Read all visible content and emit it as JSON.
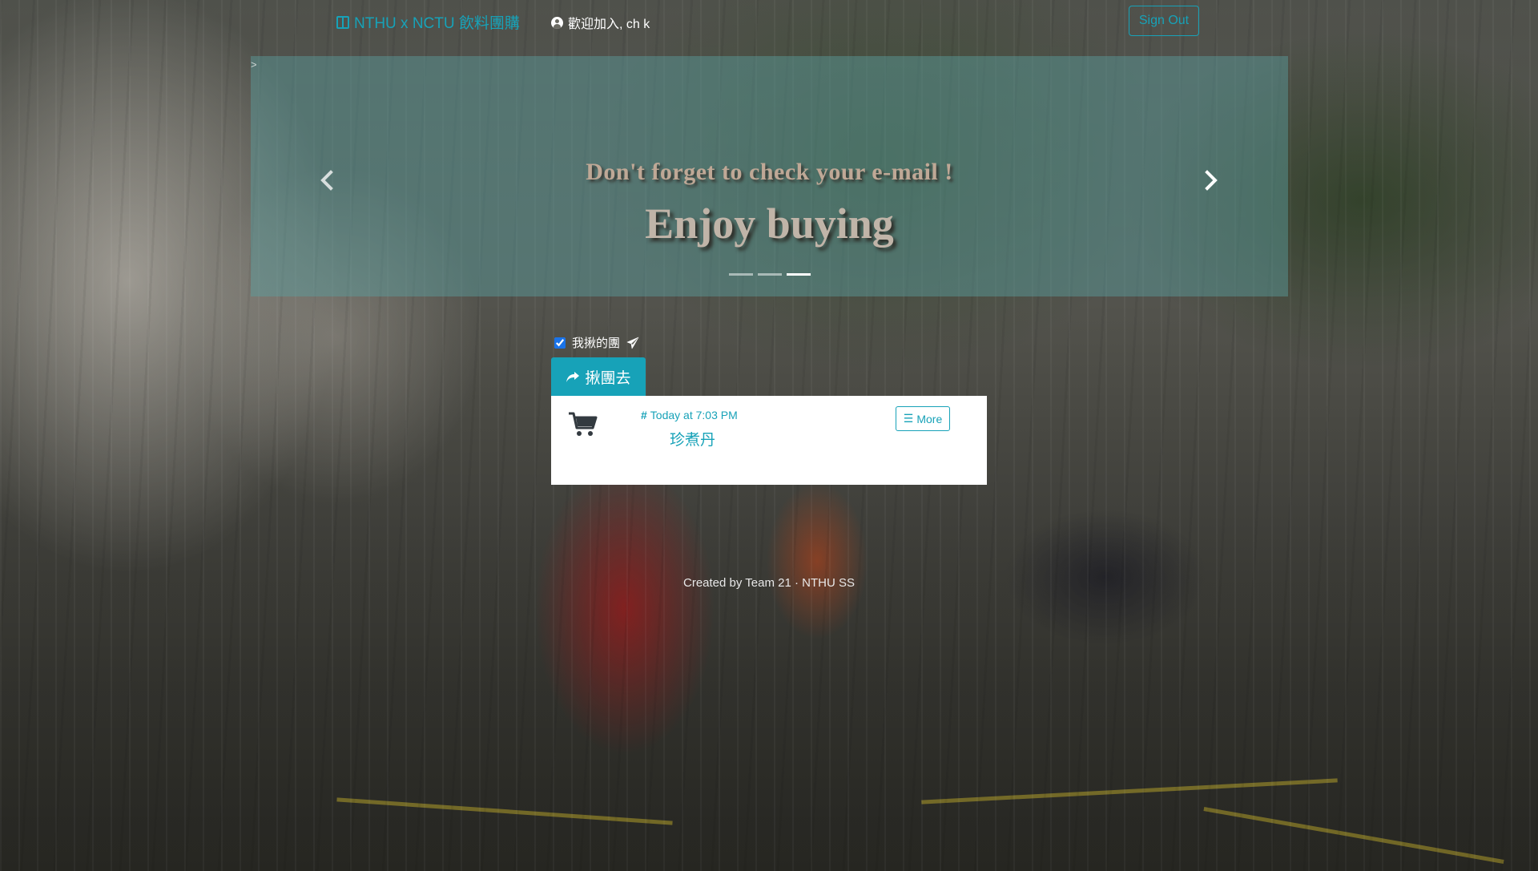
{
  "navbar": {
    "brand": "NTHU x NCTU 飲料團購",
    "brand_icon": "book-icon",
    "welcome": "歡迎加入, ch k",
    "user_icon": "user-circle-icon",
    "signout_label": "Sign Out"
  },
  "carousel": {
    "stray_text": ">",
    "caption_line1": "Don't forget to check your e-mail !",
    "caption_line2": "Enjoy buying",
    "slide_count": 3,
    "active_slide": 3
  },
  "filter": {
    "label": "我揪的團",
    "checked": true,
    "icon": "paper-plane-icon"
  },
  "create_button": {
    "label": "揪團去",
    "icon": "share-arrow-icon"
  },
  "groups": [
    {
      "time": "Today at 7:03 PM",
      "title": "珍煮丹",
      "more_label": "More",
      "icon": "shopping-cart-icon"
    }
  ],
  "footer": {
    "text": "Created by Team 21 · NTHU SS"
  },
  "colors": {
    "accent": "#17a2b8",
    "carousel_overlay": "#5ca0a0"
  }
}
